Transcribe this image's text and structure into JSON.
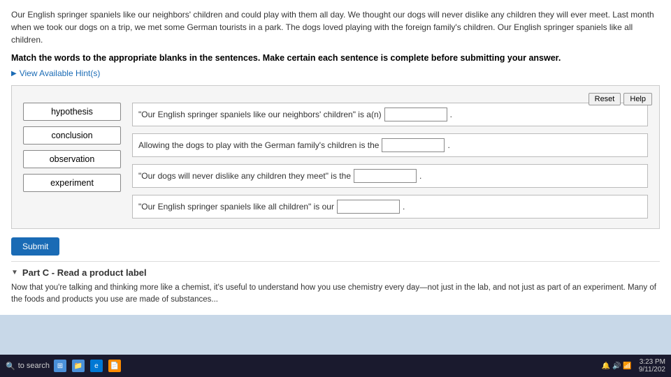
{
  "intro": {
    "text": "Our English springer spaniels like our neighbors' children and could play with them all day. We thought our dogs will never dislike any children they will ever meet. Last month when we took our dogs on a trip, we met some German tourists in a park. The dogs loved playing with the foreign family's children. Our English springer spaniels like all children.",
    "instruction": "Match the words to the appropriate blanks in the sentences. Make certain each sentence is complete before submitting your answer."
  },
  "hint": {
    "label": "View Available Hint(s)"
  },
  "buttons": {
    "reset": "Reset",
    "help": "Help",
    "submit": "Submit"
  },
  "words": [
    {
      "id": "hypothesis",
      "label": "hypothesis"
    },
    {
      "id": "conclusion",
      "label": "conclusion"
    },
    {
      "id": "observation",
      "label": "observation"
    },
    {
      "id": "experiment",
      "label": "experiment"
    }
  ],
  "sentences": [
    {
      "id": "s1",
      "before": "\"Our English springer spaniels like our neighbors' children\" is a(n)",
      "after": "."
    },
    {
      "id": "s2",
      "before": "Allowing the dogs to play with the German family's children is the",
      "after": "."
    },
    {
      "id": "s3",
      "before": "\"Our dogs will never dislike any children they meet\" is the",
      "after": "."
    },
    {
      "id": "s4",
      "before": "\"Our English springer spaniels like all children\" is our",
      "after": "."
    }
  ],
  "partC": {
    "header": "Part C - Read a product label",
    "text": "Now that you're talking and thinking more like a chemist, it's useful to understand how you use chemistry every day—not just in the lab, and not just as part of an experiment. Many of the foods and products you use are made of substances..."
  },
  "taskbar": {
    "search_label": "to search",
    "time": "3:23 PM",
    "date": "9/11/202"
  }
}
